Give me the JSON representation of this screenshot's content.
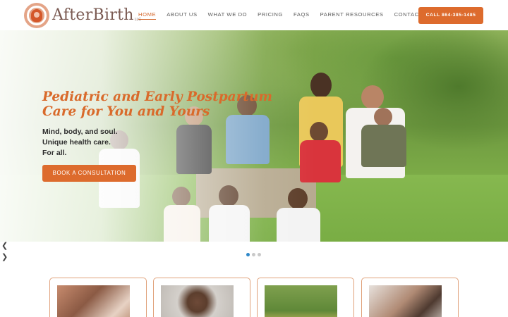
{
  "brand": {
    "name": "AfterBirth",
    "suffix": "LLC"
  },
  "nav": {
    "items": [
      {
        "label": "HOME",
        "active": true
      },
      {
        "label": "ABOUT US",
        "active": false
      },
      {
        "label": "WHAT WE DO",
        "active": false
      },
      {
        "label": "PRICING",
        "active": false
      },
      {
        "label": "FAQS",
        "active": false
      },
      {
        "label": "PARENT RESOURCES",
        "active": false
      },
      {
        "label": "CONTACT",
        "active": false
      }
    ],
    "cta": "CALL 864-385-1485"
  },
  "hero": {
    "title_line1": "Pediatric and Early Postpartum",
    "title_line2": "Care for You and Yours",
    "lines": [
      "Mind, body, and soul.",
      "Unique health care.",
      "For all."
    ],
    "button": "BOOK A CONSULTATION"
  },
  "slider": {
    "prev_icon": "chevron-left-icon",
    "next_icon": "chevron-right-icon",
    "total_slides": 3,
    "active_slide": 1
  },
  "colors": {
    "accent": "#dd6b2d",
    "title": "#d96a2b",
    "card_border": "#e0a17a",
    "active_dot": "#2f88c9"
  }
}
